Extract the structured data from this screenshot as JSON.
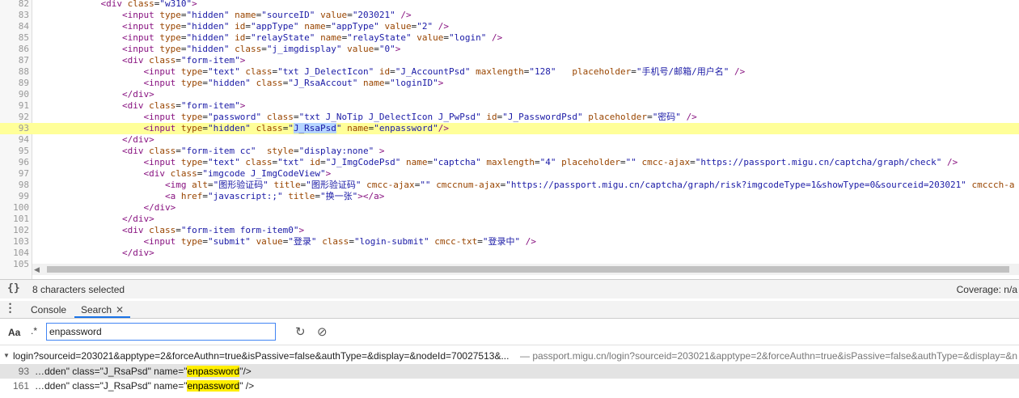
{
  "editor": {
    "lines": [
      {
        "n": "82",
        "html": "            <span class=\"t\">&lt;div</span> <span class=\"a\">class</span><span class=\"p\">=</span><span class=\"v\">\"w310\"</span><span class=\"t\">&gt;</span>"
      },
      {
        "n": "83",
        "html": "                <span class=\"t\">&lt;input</span> <span class=\"a\">type</span><span class=\"p\">=</span><span class=\"v\">\"hidden\"</span> <span class=\"a\">name</span><span class=\"p\">=</span><span class=\"v\">\"sourceID\"</span> <span class=\"a\">value</span><span class=\"p\">=</span><span class=\"v\">\"203021\"</span> <span class=\"t\">/&gt;</span>"
      },
      {
        "n": "84",
        "html": "                <span class=\"t\">&lt;input</span> <span class=\"a\">type</span><span class=\"p\">=</span><span class=\"v\">\"hidden\"</span> <span class=\"a\">id</span><span class=\"p\">=</span><span class=\"v\">\"appType\"</span> <span class=\"a\">name</span><span class=\"p\">=</span><span class=\"v\">\"appType\"</span> <span class=\"a\">value</span><span class=\"p\">=</span><span class=\"v\">\"2\"</span> <span class=\"t\">/&gt;</span>"
      },
      {
        "n": "85",
        "html": "                <span class=\"t\">&lt;input</span> <span class=\"a\">type</span><span class=\"p\">=</span><span class=\"v\">\"hidden\"</span> <span class=\"a\">id</span><span class=\"p\">=</span><span class=\"v\">\"relayState\"</span> <span class=\"a\">name</span><span class=\"p\">=</span><span class=\"v\">\"relayState\"</span> <span class=\"a\">value</span><span class=\"p\">=</span><span class=\"v\">\"login\"</span> <span class=\"t\">/&gt;</span>"
      },
      {
        "n": "86",
        "html": "                <span class=\"t\">&lt;input</span> <span class=\"a\">type</span><span class=\"p\">=</span><span class=\"v\">\"hidden\"</span> <span class=\"a\">class</span><span class=\"p\">=</span><span class=\"v\">\"j_imgdisplay\"</span> <span class=\"a\">value</span><span class=\"p\">=</span><span class=\"v\">\"0\"</span><span class=\"t\">&gt;</span>"
      },
      {
        "n": "87",
        "html": "                <span class=\"t\">&lt;div</span> <span class=\"a\">class</span><span class=\"p\">=</span><span class=\"v\">\"form-item\"</span><span class=\"t\">&gt;</span>"
      },
      {
        "n": "88",
        "html": "                    <span class=\"t\">&lt;input</span> <span class=\"a\">type</span><span class=\"p\">=</span><span class=\"v\">\"text\"</span> <span class=\"a\">class</span><span class=\"p\">=</span><span class=\"v\">\"txt J_DelectIcon\"</span> <span class=\"a\">id</span><span class=\"p\">=</span><span class=\"v\">\"J_AccountPsd\"</span> <span class=\"a\">maxlength</span><span class=\"p\">=</span><span class=\"v\">\"128\"</span>   <span class=\"a\">placeholder</span><span class=\"p\">=</span><span class=\"v\">\"手机号/邮箱/用户名\"</span> <span class=\"t\">/&gt;</span>"
      },
      {
        "n": "89",
        "html": "                    <span class=\"t\">&lt;input</span> <span class=\"a\">type</span><span class=\"p\">=</span><span class=\"v\">\"hidden\"</span> <span class=\"a\">class</span><span class=\"p\">=</span><span class=\"v\">\"J_RsaAccout\"</span> <span class=\"a\">name</span><span class=\"p\">=</span><span class=\"v\">\"loginID\"</span><span class=\"t\">&gt;</span>"
      },
      {
        "n": "90",
        "html": "                <span class=\"t\">&lt;/div&gt;</span>"
      },
      {
        "n": "91",
        "html": "                <span class=\"t\">&lt;div</span> <span class=\"a\">class</span><span class=\"p\">=</span><span class=\"v\">\"form-item\"</span><span class=\"t\">&gt;</span>"
      },
      {
        "n": "92",
        "html": "                    <span class=\"t\">&lt;input</span> <span class=\"a\">type</span><span class=\"p\">=</span><span class=\"v\">\"password\"</span> <span class=\"a\">class</span><span class=\"p\">=</span><span class=\"v\">\"txt J_NoTip J_DelectIcon J_PwPsd\"</span> <span class=\"a\">id</span><span class=\"p\">=</span><span class=\"v\">\"J_PasswordPsd\"</span> <span class=\"a\">placeholder</span><span class=\"p\">=</span><span class=\"v\">\"密码\"</span> <span class=\"t\">/&gt;</span>"
      },
      {
        "n": "93",
        "hl": true,
        "html": "                    <span class=\"t\">&lt;input</span> <span class=\"a\">type</span><span class=\"p\">=</span><span class=\"v\">\"hidden\"</span> <span class=\"a\">class</span><span class=\"p\">=</span><span class=\"v\">\"<span class=\"sel\">J_RsaPsd</span>\"</span> <span class=\"a\">name</span><span class=\"p\">=</span><span class=\"v\">\"enpassword\"</span><span class=\"t\">/&gt;</span>"
      },
      {
        "n": "94",
        "html": "                <span class=\"t\">&lt;/div&gt;</span>"
      },
      {
        "n": "95",
        "html": "                <span class=\"t\">&lt;div</span> <span class=\"a\">class</span><span class=\"p\">=</span><span class=\"v\">\"form-item cc\"</span>  <span class=\"a\">style</span><span class=\"p\">=</span><span class=\"v\">\"display:none\"</span> <span class=\"t\">&gt;</span>"
      },
      {
        "n": "96",
        "html": "                    <span class=\"t\">&lt;input</span> <span class=\"a\">type</span><span class=\"p\">=</span><span class=\"v\">\"text\"</span> <span class=\"a\">class</span><span class=\"p\">=</span><span class=\"v\">\"txt\"</span> <span class=\"a\">id</span><span class=\"p\">=</span><span class=\"v\">\"J_ImgCodePsd\"</span> <span class=\"a\">name</span><span class=\"p\">=</span><span class=\"v\">\"captcha\"</span> <span class=\"a\">maxlength</span><span class=\"p\">=</span><span class=\"v\">\"4\"</span> <span class=\"a\">placeholder</span><span class=\"p\">=</span><span class=\"v\">\"\"</span> <span class=\"a\">cmcc-ajax</span><span class=\"p\">=</span><span class=\"v\">\"https://passport.migu.cn/captcha/graph/check\"</span> <span class=\"t\">/&gt;</span>"
      },
      {
        "n": "97",
        "html": "                    <span class=\"t\">&lt;div</span> <span class=\"a\">class</span><span class=\"p\">=</span><span class=\"v\">\"imgcode J_ImgCodeView\"</span><span class=\"t\">&gt;</span>"
      },
      {
        "n": "98",
        "html": "                        <span class=\"t\">&lt;img</span> <span class=\"a\">alt</span><span class=\"p\">=</span><span class=\"v\">\"图形验证码\"</span> <span class=\"a\">title</span><span class=\"p\">=</span><span class=\"v\">\"图形验证码\"</span> <span class=\"a\">cmcc-ajax</span><span class=\"p\">=</span><span class=\"v\">\"\"</span> <span class=\"a\">cmccnum-ajax</span><span class=\"p\">=</span><span class=\"v\">\"https://passport.migu.cn/captcha/graph/risk?imgcodeType=1&amp;showType=0&amp;sourceid=203021\"</span> <span class=\"a\">cmccch-a</span>"
      },
      {
        "n": "99",
        "html": "                        <span class=\"t\">&lt;a</span> <span class=\"a\">href</span><span class=\"p\">=</span><span class=\"v\">\"javascript:;\"</span> <span class=\"a\">title</span><span class=\"p\">=</span><span class=\"v\">\"换一张\"</span><span class=\"t\">&gt;&lt;/a&gt;</span>"
      },
      {
        "n": "100",
        "html": "                    <span class=\"t\">&lt;/div&gt;</span>"
      },
      {
        "n": "101",
        "html": "                <span class=\"t\">&lt;/div&gt;</span>"
      },
      {
        "n": "102",
        "html": "                <span class=\"t\">&lt;div</span> <span class=\"a\">class</span><span class=\"p\">=</span><span class=\"v\">\"form-item form-item0\"</span><span class=\"t\">&gt;</span>"
      },
      {
        "n": "103",
        "html": "                    <span class=\"t\">&lt;input</span> <span class=\"a\">type</span><span class=\"p\">=</span><span class=\"v\">\"submit\"</span> <span class=\"a\">value</span><span class=\"p\">=</span><span class=\"v\">\"登录\"</span> <span class=\"a\">class</span><span class=\"p\">=</span><span class=\"v\">\"login-submit\"</span> <span class=\"a\">cmcc-txt</span><span class=\"p\">=</span><span class=\"v\">\"登录中\"</span> <span class=\"t\">/&gt;</span>"
      },
      {
        "n": "104",
        "html": "                <span class=\"t\">&lt;/div&gt;</span>"
      },
      {
        "n": "105",
        "html": ""
      }
    ]
  },
  "status": {
    "braces": "{}",
    "selection": "8 characters selected",
    "coverage": "Coverage: n/a"
  },
  "drawer": {
    "tab_console": "Console",
    "tab_search": "Search",
    "close_glyph": "✕"
  },
  "search": {
    "case_label": "Aa",
    "regex_label": ".*",
    "query": "enpassword",
    "refresh_glyph": "↻",
    "clear_glyph": "⊘"
  },
  "results": {
    "file_name": "login?sourceid=203021&apptype=2&forceAuthn=true&isPassive=false&authType=&display=&nodeId=70027513&...",
    "file_url": "— passport.migu.cn/login?sourceid=203021&apptype=2&forceAuthn=true&isPassive=false&authType=&display=&n",
    "matches": [
      {
        "line": "93",
        "before": "…dden\" class=\"J_RsaPsd\" name=\"",
        "hit": "enpassword",
        "after": "\"/>",
        "active": true
      },
      {
        "line": "161",
        "before": "…dden\" class=\"J_RsaPsd\" name=\"",
        "hit": "enpassword",
        "after": "\" />",
        "active": false
      }
    ]
  }
}
